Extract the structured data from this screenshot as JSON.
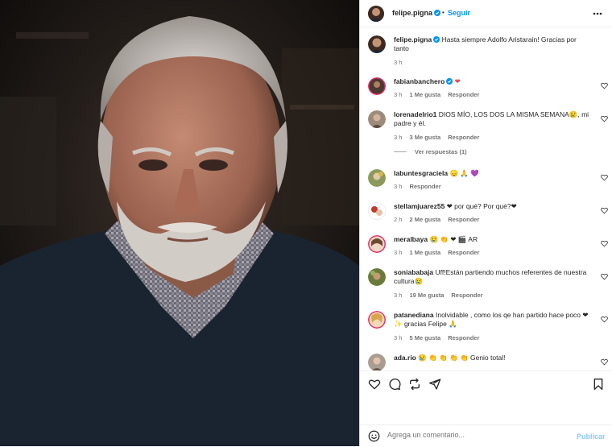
{
  "post": {
    "username": "felipe.pigna",
    "dot": "•",
    "follow_label": "Seguir",
    "caption_user": "felipe.pigna",
    "caption_text": "Hasta siempre Adolfo Aristarain! Gracias por tanto",
    "caption_time": "3 h"
  },
  "comments": [
    {
      "user": "fabianbanchero",
      "verified": true,
      "text": "",
      "emoji": "❤",
      "time": "3 h",
      "likes": "1 Me gusta",
      "reply": "Responder"
    },
    {
      "user": "lorenadelrio1",
      "text": "DIOS MÍO, LOS DOS LA MISMA SEMANA😢, mi padre y él.",
      "time": "3 h",
      "likes": "3 Me gusta",
      "reply": "Responder",
      "view_replies": "Ver respuestas (1)"
    },
    {
      "user": "labuntesgraciela",
      "text": "😞 🙏 💜",
      "time": "3 h",
      "likes": "",
      "reply": "Responder"
    },
    {
      "user": "stellamjuarez55",
      "text": "❤ por qué? Por qué?❤",
      "time": "2 h",
      "likes": "2 Me gusta",
      "reply": "Responder"
    },
    {
      "user": "meralbaya",
      "text": "😢 👏 ❤ 🎬 AR",
      "time": "3 h",
      "likes": "1 Me gusta",
      "reply": "Responder"
    },
    {
      "user": "soniababaja",
      "text": "Uff!Están partiendo muchos referentes de nuestra cultura😢",
      "time": "3 h",
      "likes": "19 Me gusta",
      "reply": "Responder"
    },
    {
      "user": "patanediana",
      "text": "Inolvidable , como los qe han partido hace poco ❤ ✨ gracias Felipe 🙏",
      "time": "3 h",
      "likes": "5 Me gusta",
      "reply": "Responder"
    },
    {
      "user": "ada.rio",
      "text": "😢 👏 👏 👏 👏 Genio total!",
      "time": "",
      "likes": "",
      "reply": ""
    }
  ],
  "compose": {
    "emoji_icon": "smile-icon",
    "placeholder": "Agrega un comentario...",
    "publish_label": "Publicar"
  },
  "colors": {
    "link": "#0095f6",
    "muted": "#737373",
    "verified": "#0095f6"
  }
}
